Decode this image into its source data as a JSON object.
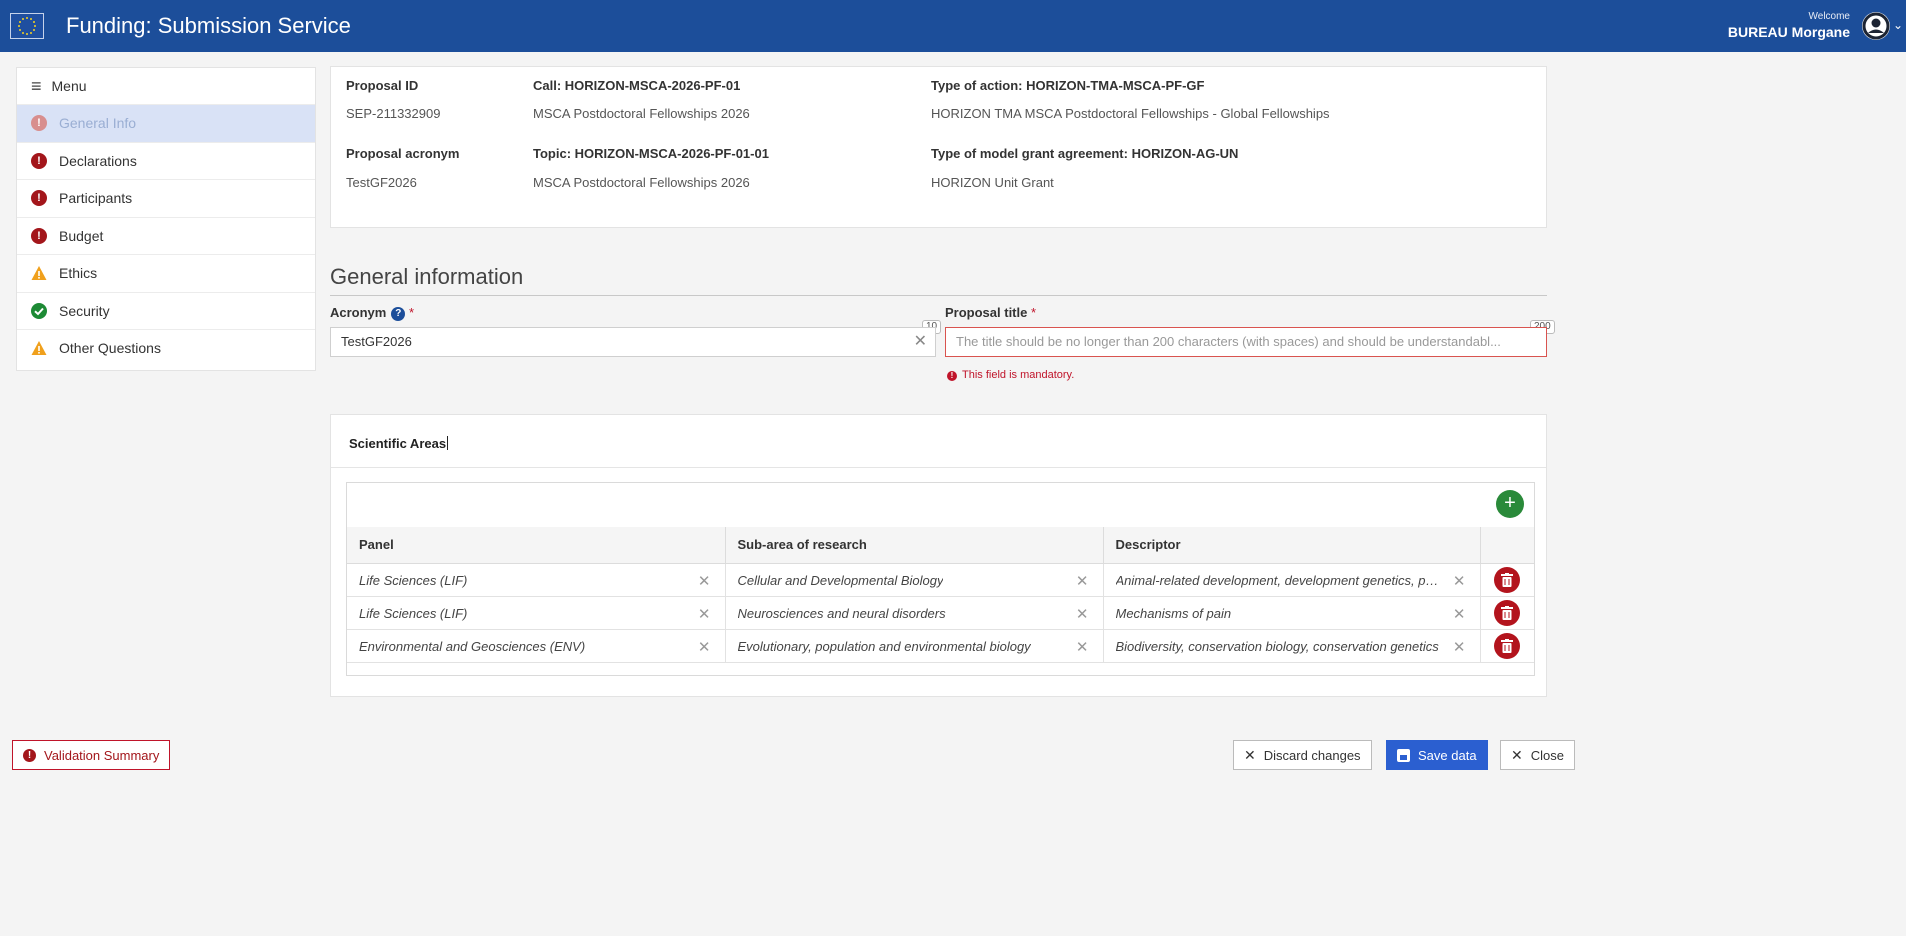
{
  "header": {
    "title": "Funding: Submission Service",
    "welcome": "Welcome",
    "user": "BUREAU Morgane"
  },
  "sidebar": {
    "menu_label": "Menu",
    "items": [
      {
        "label": "General Info",
        "status": "error",
        "active": true
      },
      {
        "label": "Declarations",
        "status": "error"
      },
      {
        "label": "Participants",
        "status": "error"
      },
      {
        "label": "Budget",
        "status": "error"
      },
      {
        "label": "Ethics",
        "status": "warning"
      },
      {
        "label": "Security",
        "status": "ok"
      },
      {
        "label": "Other Questions",
        "status": "warning"
      }
    ]
  },
  "proposal": {
    "id_label": "Proposal ID",
    "id_value": "SEP-211332909",
    "call_label": "Call: HORIZON-MSCA-2026-PF-01",
    "call_value": "MSCA Postdoctoral Fellowships 2026",
    "action_label": "Type of action: HORIZON-TMA-MSCA-PF-GF",
    "action_value": "HORIZON TMA MSCA Postdoctoral Fellowships - Global Fellowships",
    "acronym_label": "Proposal acronym",
    "acronym_value": "TestGF2026",
    "topic_label": "Topic: HORIZON-MSCA-2026-PF-01-01",
    "topic_value": "MSCA Postdoctoral Fellowships 2026",
    "mga_label": "Type of model grant agreement: HORIZON-AG-UN",
    "mga_value": "HORIZON Unit Grant"
  },
  "general": {
    "section_title": "General information",
    "acronym_label": "Acronym",
    "acronym_value": "TestGF2026",
    "acronym_counter": "10",
    "title_label": "Proposal title",
    "title_placeholder": "The title should be no longer than 200 characters (with spaces) and should be understandabl...",
    "title_counter": "200",
    "title_error": "This field is mandatory.",
    "required_mark": "*"
  },
  "scientific": {
    "title": "Scientific Areas",
    "columns": [
      "Panel",
      "Sub-area of research",
      "Descriptor"
    ],
    "rows": [
      [
        "Life Sciences (LIF)",
        "Cellular and Developmental Biology",
        "Animal-related development, development genetics, pa…"
      ],
      [
        "Life Sciences (LIF)",
        "Neurosciences and neural disorders",
        "Mechanisms of pain"
      ],
      [
        "Environmental and Geosciences (ENV)",
        "Evolutionary, population and environmental biology",
        "Biodiversity, conservation biology, conservation genetics"
      ]
    ]
  },
  "footer": {
    "validation_summary": "Validation Summary",
    "discard": "Discard changes",
    "save": "Save data",
    "close": "Close"
  },
  "colors": {
    "header_bg": "#1c4e9a",
    "error": "#a3161b",
    "ok": "#1d8a35",
    "warning": "#f0a01c",
    "primary_button": "#2b5fd0"
  }
}
